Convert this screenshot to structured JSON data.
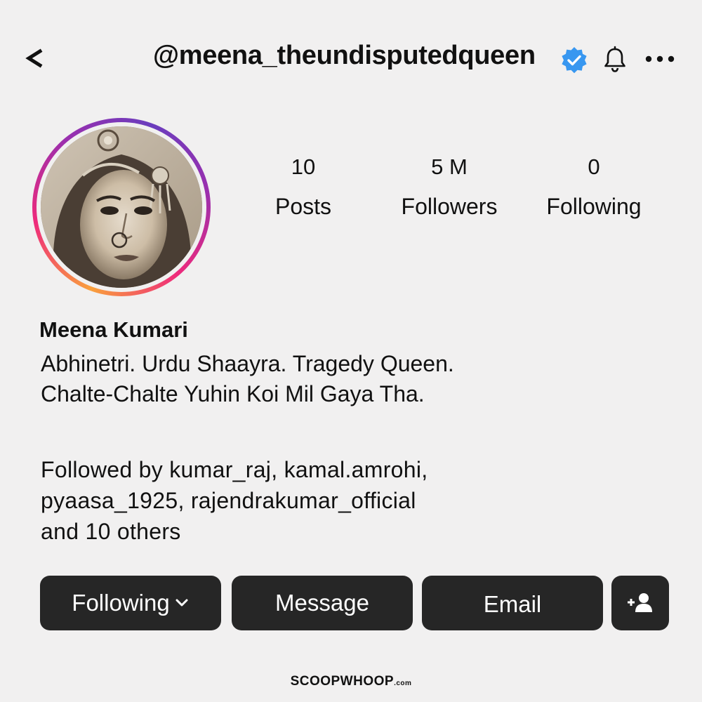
{
  "header": {
    "back_label": "<",
    "username": "@meena_theundisputedqueen",
    "verified_icon": "verified-badge-icon",
    "bell_icon": "bell-icon",
    "more_icon": "more-options-icon",
    "verified_color": "#3897f0"
  },
  "profile": {
    "avatar_icon": "avatar"
  },
  "stats": [
    {
      "count": "10",
      "label": "Posts"
    },
    {
      "count": "5 M",
      "label": "Followers"
    },
    {
      "count": "0",
      "label": "Following"
    }
  ],
  "bio": {
    "name": "Meena Kumari",
    "lines": [
      "Abhinetri. Urdu Shaayra. Tragedy Queen.",
      "Chalte-Chalte Yuhin Koi Mil Gaya Tha."
    ],
    "followed_by": [
      "Followed by kumar_raj, kamal.amrohi,",
      "pyaasa_1925, rajendrakumar_official",
      "and 10 others"
    ]
  },
  "actions": {
    "following_label": "Following",
    "message_label": "Message",
    "email_label": "Email",
    "add_user_icon": "add-user-icon",
    "button_color": "#262626"
  },
  "footer": {
    "brand": "SCOOPWHOOP",
    "brand_suffix": ".com"
  }
}
